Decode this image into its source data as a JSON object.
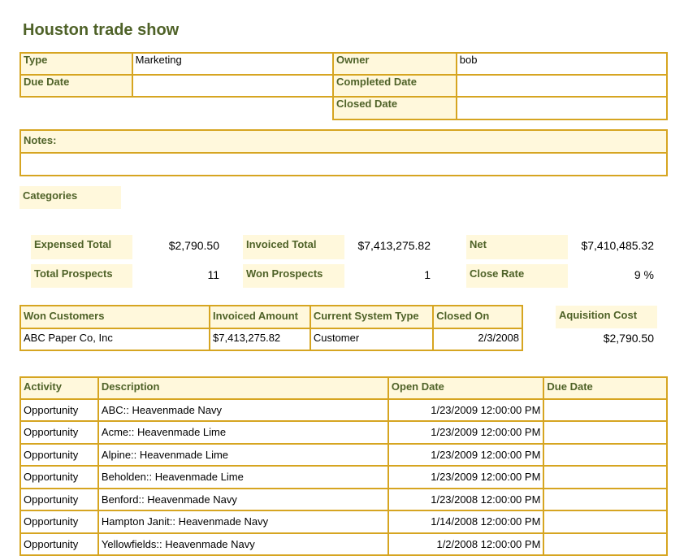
{
  "title": "Houston trade show",
  "details": {
    "type_label": "Type",
    "type_value": "Marketing",
    "owner_label": "Owner",
    "owner_value": "bob",
    "due_date_label": "Due Date",
    "due_date_value": "",
    "completed_date_label": "Completed Date",
    "completed_date_value": "",
    "closed_date_label": "Closed Date",
    "closed_date_value": ""
  },
  "notes": {
    "label": "Notes:",
    "value": ""
  },
  "categories_label": "Categories",
  "summary": {
    "expensed_total_label": "Expensed Total",
    "expensed_total_value": "$2,790.50",
    "invoiced_total_label": "Invoiced Total",
    "invoiced_total_value": "$7,413,275.82",
    "net_label": "Net",
    "net_value": "$7,410,485.32",
    "total_prospects_label": "Total Prospects",
    "total_prospects_value": "11",
    "won_prospects_label": "Won Prospects",
    "won_prospects_value": "1",
    "close_rate_label": "Close Rate",
    "close_rate_value": "9 %"
  },
  "won_customers": {
    "headers": [
      "Won Customers",
      "Invoiced Amount",
      "Current System Type",
      "Closed On"
    ],
    "rows": [
      [
        "ABC Paper Co, Inc",
        "$7,413,275.82",
        "Customer",
        "2/3/2008"
      ]
    ]
  },
  "acquisition": {
    "label": "Aquisition Cost",
    "value": "$2,790.50"
  },
  "activities": {
    "headers": [
      "Activity",
      "Description",
      "Open Date",
      "Due Date"
    ],
    "rows": [
      [
        "Opportunity",
        "ABC:: Heavenmade Navy",
        "1/23/2009 12:00:00 PM",
        ""
      ],
      [
        "Opportunity",
        "Acme:: Heavenmade Lime",
        "1/23/2009 12:00:00 PM",
        ""
      ],
      [
        "Opportunity",
        "Alpine:: Heavenmade Lime",
        "1/23/2009 12:00:00 PM",
        ""
      ],
      [
        "Opportunity",
        "Beholden:: Heavenmade Lime",
        "1/23/2009 12:00:00 PM",
        ""
      ],
      [
        "Opportunity",
        "Benford:: Heavenmade Navy",
        "1/23/2008 12:00:00 PM",
        ""
      ],
      [
        "Opportunity",
        "Hampton Janit:: Heavenmade Navy",
        "1/14/2008 12:00:00 PM",
        ""
      ],
      [
        "Opportunity",
        "Yellowfields:: Heavenmade Navy",
        "1/2/2008 12:00:00 PM",
        ""
      ]
    ]
  }
}
